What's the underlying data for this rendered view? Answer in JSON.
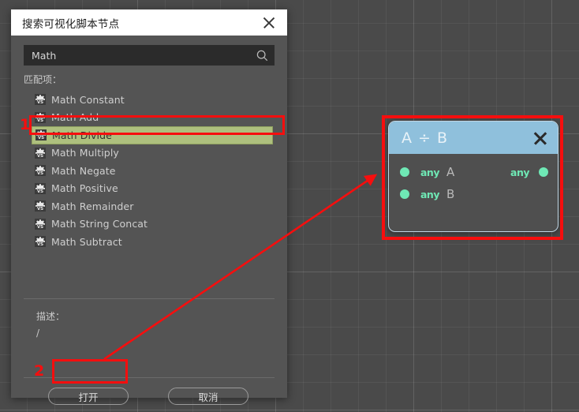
{
  "dialog": {
    "title": "搜索可视化脚本节点",
    "close_icon": "close-icon",
    "search": {
      "value": "Math",
      "placeholder": "Math",
      "icon": "search-icon"
    },
    "matches_label": "匹配项：",
    "results": [
      {
        "label": "Math Constant",
        "icon": "vs-node-icon",
        "selected": false
      },
      {
        "label": "Math Add",
        "icon": "vs-node-icon",
        "selected": false
      },
      {
        "label": "Math Divide",
        "icon": "vs-node-icon",
        "selected": true
      },
      {
        "label": "Math Multiply",
        "icon": "vs-node-icon",
        "selected": false
      },
      {
        "label": "Math Negate",
        "icon": "vs-node-icon",
        "selected": false
      },
      {
        "label": "Math Positive",
        "icon": "vs-node-icon",
        "selected": false
      },
      {
        "label": "Math Remainder",
        "icon": "vs-node-icon",
        "selected": false
      },
      {
        "label": "Math String Concat",
        "icon": "vs-node-icon",
        "selected": false
      },
      {
        "label": "Math Subtract",
        "icon": "vs-node-icon",
        "selected": false
      }
    ],
    "description_label": "描述：",
    "description_text": "/",
    "buttons": {
      "open": "打开",
      "cancel": "取消"
    }
  },
  "node": {
    "title": "A ÷ B",
    "close_icon": "close-icon",
    "inputs": [
      {
        "type": "any",
        "name": "A"
      },
      {
        "type": "any",
        "name": "B"
      }
    ],
    "outputs": [
      {
        "type": "any",
        "name": ""
      }
    ]
  },
  "annotations": {
    "step_1": "1",
    "step_2": "2",
    "color": "#f60e0e"
  },
  "colors": {
    "canvas_bg": "#4a4a4a",
    "dialog_bg": "#545454",
    "titlebar_bg": "#ffffff",
    "selection_green": "#aec07e",
    "node_header_blue": "#8fc0dc",
    "pin_green": "#6fe8b5",
    "annotation_red": "#f60e0e"
  }
}
